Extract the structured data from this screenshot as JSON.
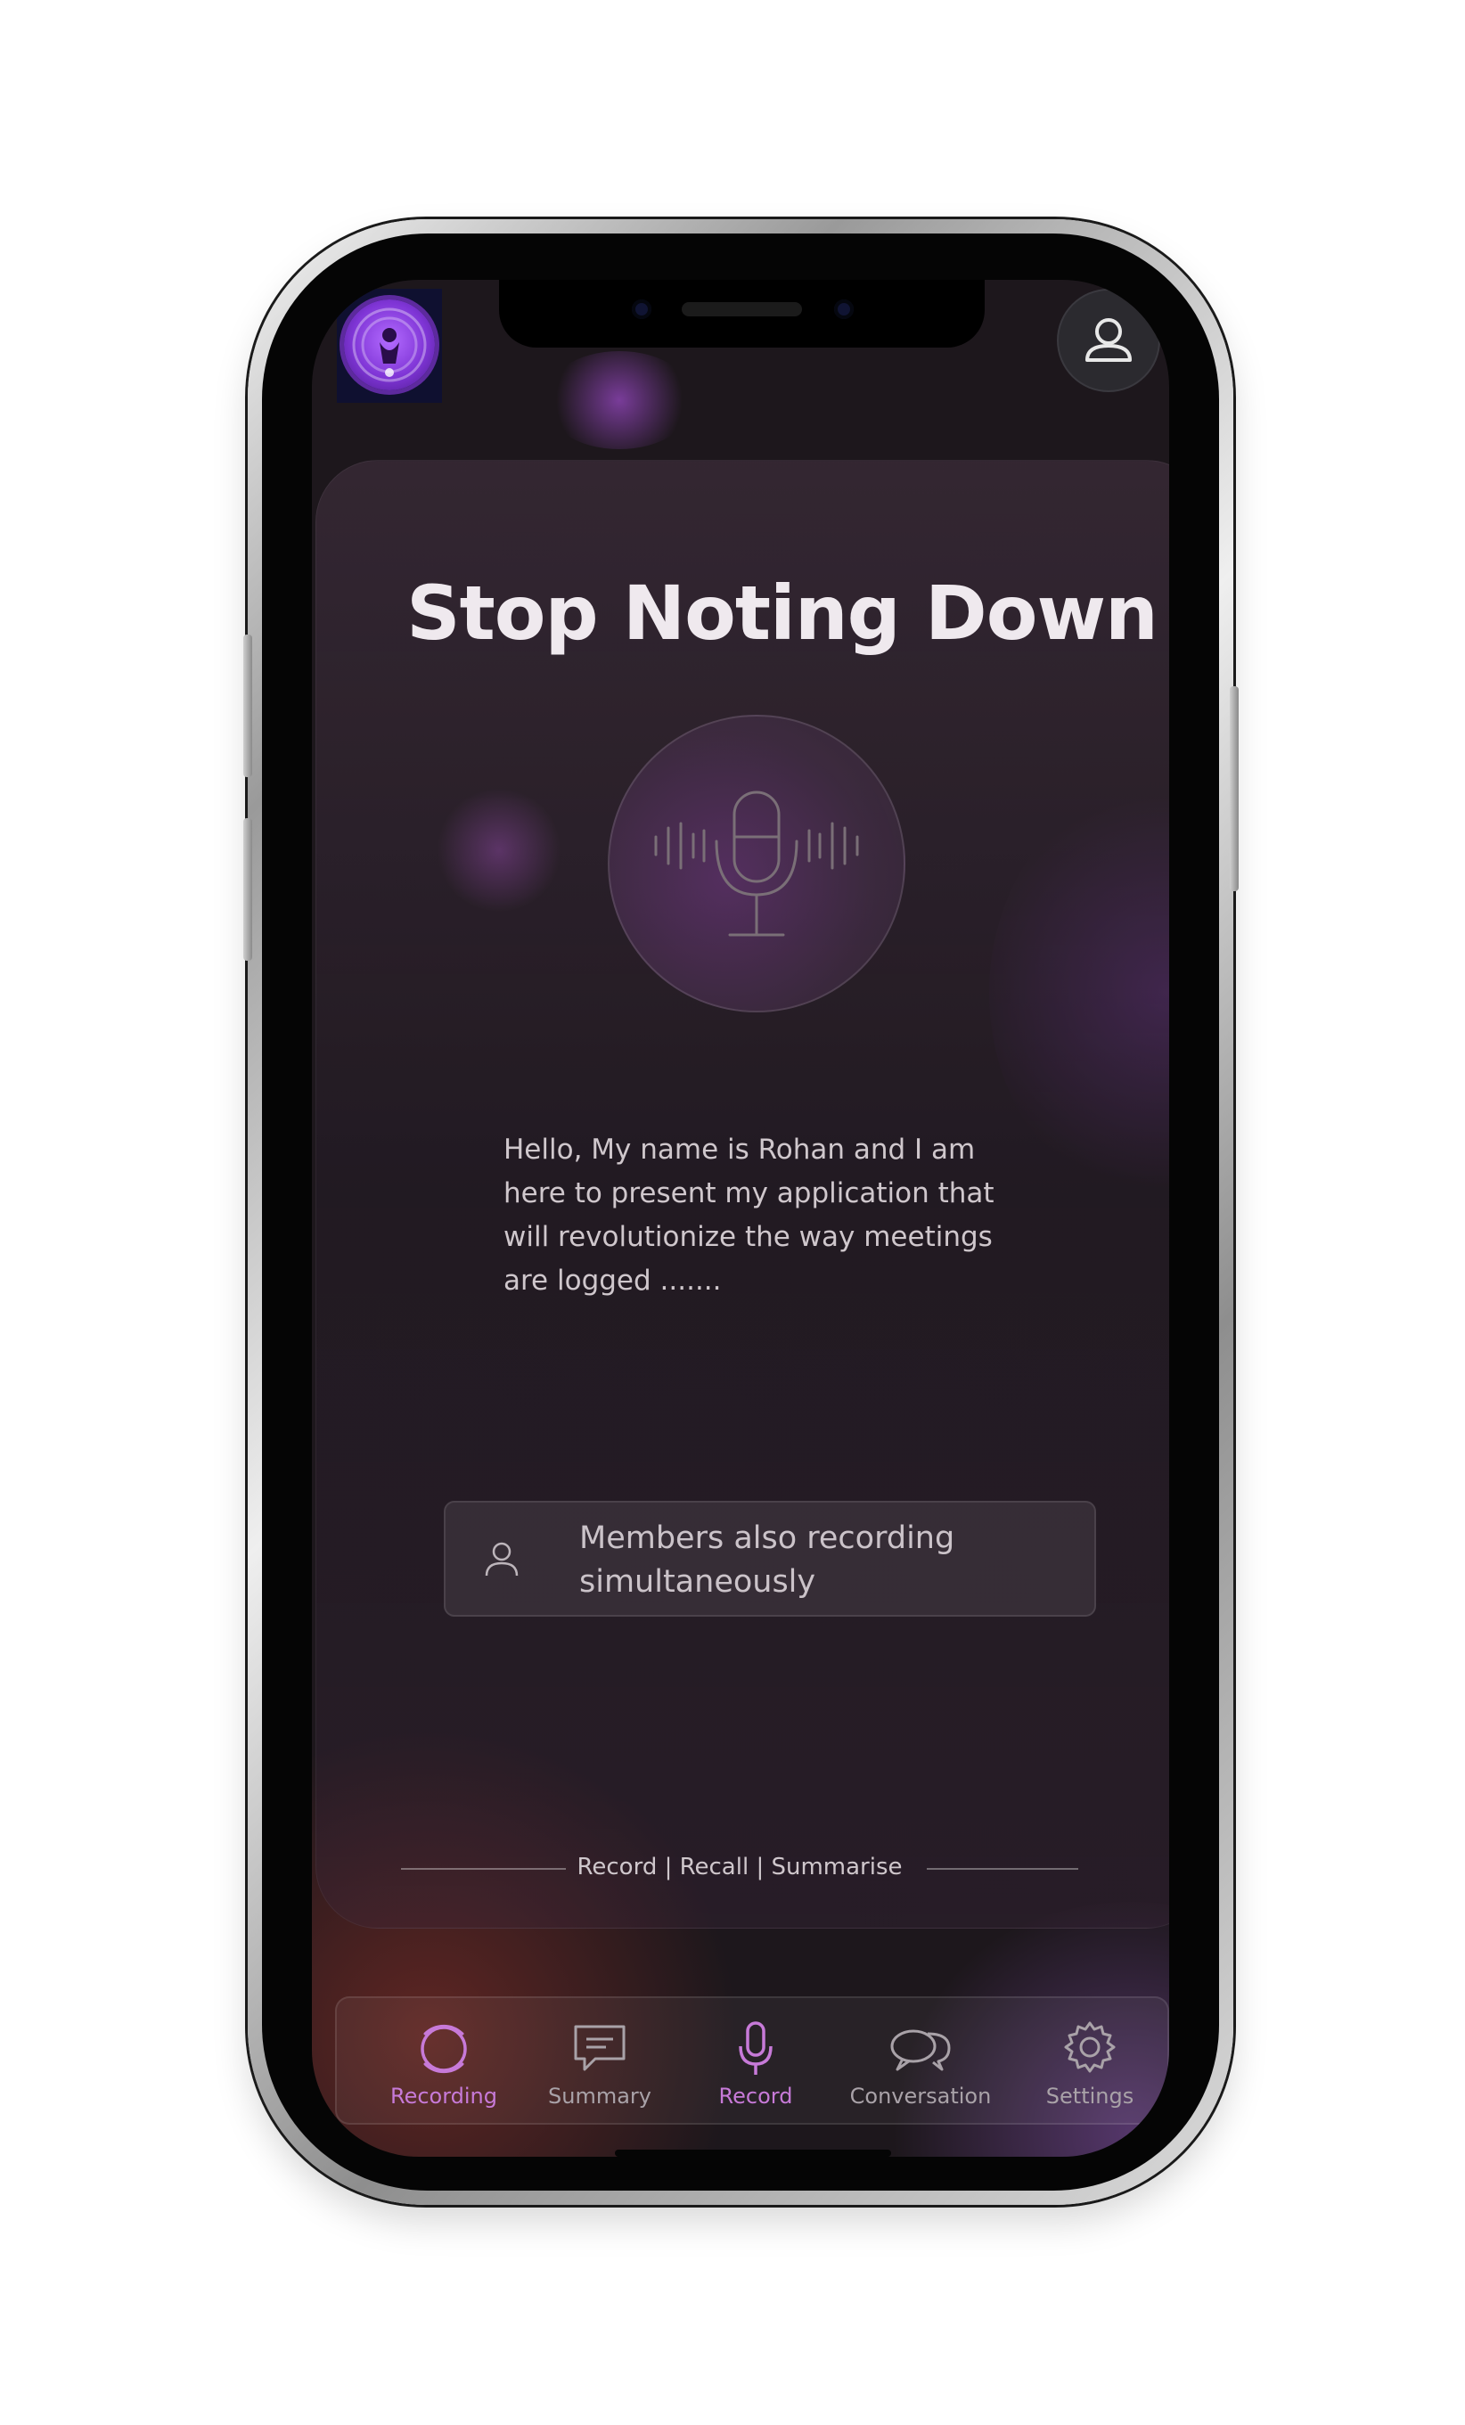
{
  "app": {
    "title": "Stop Noting Down",
    "intro_text": "Hello, My name is Rohan and I am here to present my application that will revolutionize the way meetings are logged .......",
    "members_notice": "Members also recording simultaneously",
    "tagline": "Record | Recall | Summarise"
  },
  "tabs": [
    {
      "label": "Recording",
      "icon": "recording-ring-icon",
      "active": true
    },
    {
      "label": "Summary",
      "icon": "chat-bubble-icon",
      "active": false
    },
    {
      "label": "Record",
      "icon": "microphone-icon",
      "active": true
    },
    {
      "label": "Conversation",
      "icon": "conversation-bubbles-icon",
      "active": false
    },
    {
      "label": "Settings",
      "icon": "gear-icon",
      "active": false
    }
  ],
  "colors": {
    "accent": "#c77ad8",
    "screen_bg": "#1d171c",
    "logo_purple": "#7f35d6",
    "text_light": "#efe9ee"
  }
}
